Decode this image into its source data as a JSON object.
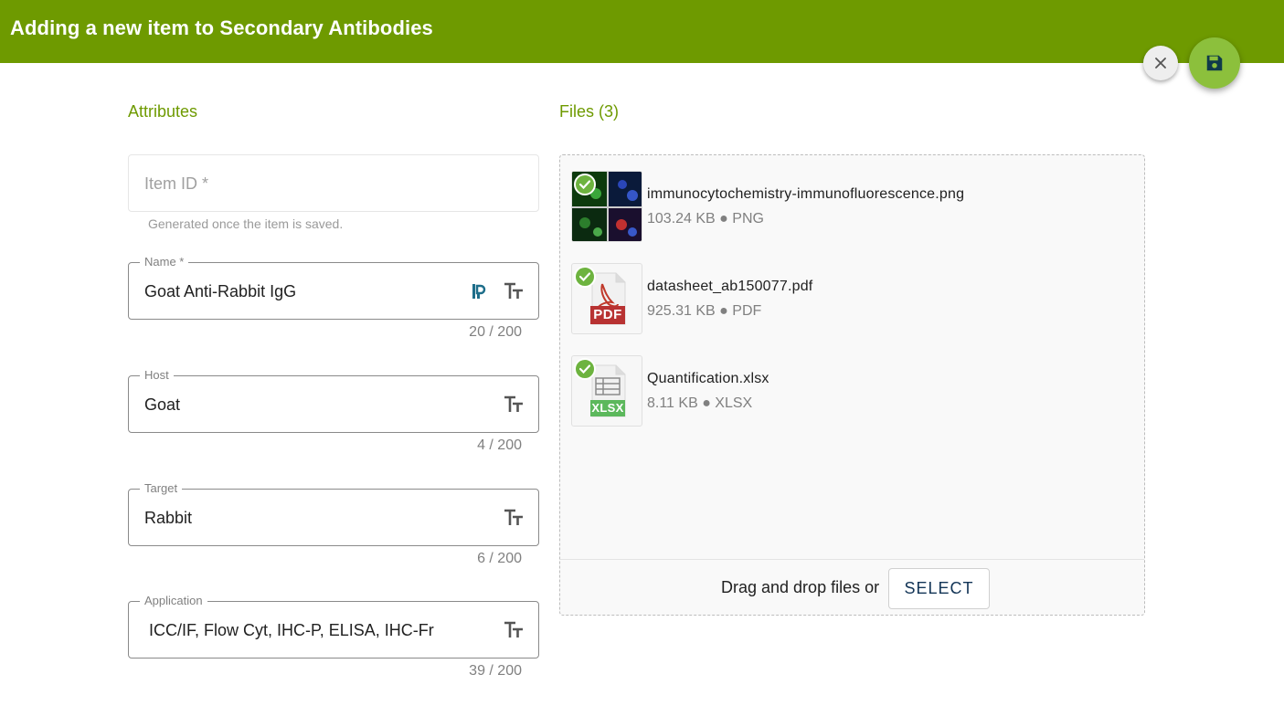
{
  "header": {
    "title": "Adding a new item to Secondary Antibodies"
  },
  "actions": {
    "close_icon": "close-icon",
    "save_icon": "floppy-disk-icon",
    "accent": "#8cc03c"
  },
  "attributes": {
    "title": "Attributes",
    "item_id": {
      "placeholder": "Item ID *",
      "hint": "Generated once the item is saved."
    },
    "fields": [
      {
        "label": "Name *",
        "value": "Goat Anti-Rabbit IgG",
        "counter": "20 / 200"
      },
      {
        "label": "Host",
        "value": "Goat",
        "counter": "4 / 200"
      },
      {
        "label": "Target",
        "value": "Rabbit",
        "counter": "6 / 200"
      },
      {
        "label": "Application",
        "value": " ICC/IF, Flow Cyt, IHC-P, ELISA, IHC-Fr",
        "counter": "39 / 200"
      }
    ]
  },
  "files": {
    "title": "Files (3)",
    "items": [
      {
        "name": "immunocytochemistry-immunofluorescence.png",
        "meta": "103.24 KB ● PNG"
      },
      {
        "name": "datasheet_ab150077.pdf",
        "meta": "925.31 KB ● PDF",
        "badge": "PDF"
      },
      {
        "name": "Quantification.xlsx",
        "meta": "8.11 KB ● XLSX",
        "badge": "XLSX"
      }
    ],
    "drop_text": "Drag and drop files or",
    "select_label": "SELECT"
  },
  "colors": {
    "header_bg": "#6e9a00",
    "section_title": "#6e9a00",
    "check": "#6db33f",
    "pdf": "#c0392b",
    "xlsx": "#5cb85c"
  }
}
